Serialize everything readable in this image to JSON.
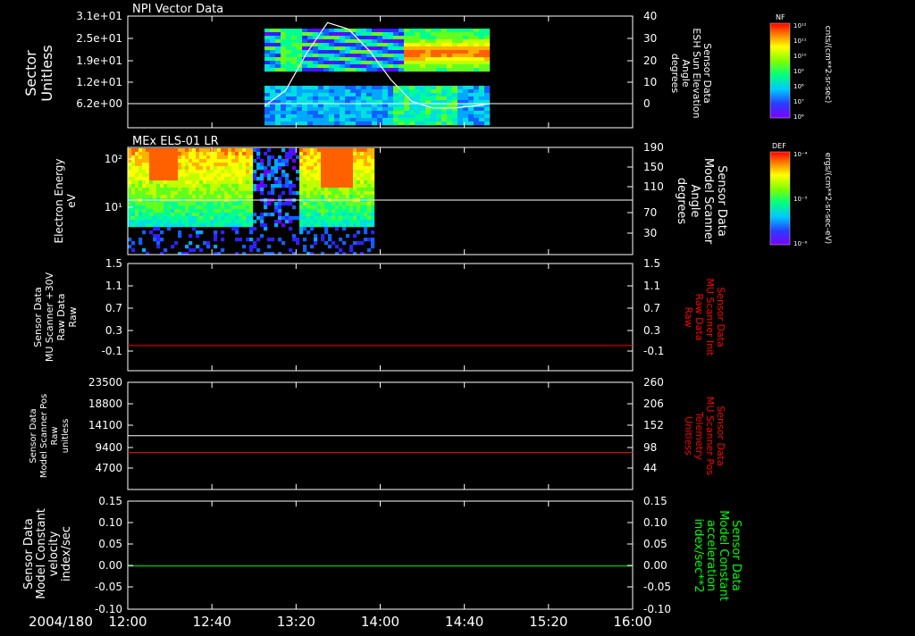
{
  "time_axis": {
    "date_label": "2004/180",
    "ticks": [
      "12:00",
      "12:40",
      "13:20",
      "14:00",
      "14:40",
      "15:20",
      "16:00"
    ],
    "start": "12:00",
    "end": "16:00"
  },
  "colors": {
    "background": "#000000",
    "axis": "#ffffff",
    "red_trace": "#ff0000",
    "green_trace": "#00ff00"
  },
  "chart_data": [
    {
      "type": "heatmap",
      "title": "NPI Vector Data",
      "ylabel": [
        "Sector",
        "Unitless"
      ],
      "yticks": [
        "3.1e+01",
        "2.5e+01",
        "1.9e+01",
        "1.2e+01",
        "6.2e+00"
      ],
      "y2label": [
        "Sensor Data",
        "ESH Sun Elevation",
        "Angle",
        "degrees"
      ],
      "y2ticks": [
        "40",
        "30",
        "20",
        "10",
        "0"
      ],
      "y2lim": [
        -5,
        40
      ],
      "colorbar": {
        "label": "NF",
        "unit": "cnts/(cm**2-sr-sec)",
        "ticks": [
          "10¹²",
          "10¹¹",
          "10¹⁰",
          "10⁹",
          "10⁸",
          "10⁷",
          "10⁶"
        ]
      },
      "data_time_range": [
        "13:05",
        "14:52"
      ],
      "overlay_line": {
        "name": "ESH Sun Elevation",
        "x": [
          "13:05",
          "13:15",
          "13:25",
          "13:35",
          "13:45",
          "13:55",
          "14:05",
          "14:15",
          "14:25",
          "14:35",
          "14:45",
          "14:52"
        ],
        "y": [
          -1,
          6,
          23,
          37,
          34,
          24,
          11,
          1,
          -2,
          -2,
          -1,
          0
        ]
      },
      "horizontal_line": {
        "y2": 0,
        "color": "white"
      }
    },
    {
      "type": "heatmap",
      "title": "MEx ELS-01 LR",
      "ylabel": [
        "Electron Energy",
        "eV"
      ],
      "yticks": [
        "10²",
        "10¹"
      ],
      "ylim": [
        1,
        200
      ],
      "y2label": [
        "Sensor Data",
        "Model Scanner",
        "Angle",
        "degrees"
      ],
      "y2ticks": [
        "190",
        "150",
        "110",
        "70",
        "30"
      ],
      "y2lim": [
        0,
        190
      ],
      "colorbar": {
        "label": "DEF",
        "unit": "ergs/(cm**2-sr-sec-eV)",
        "ticks": [
          "10⁻⁴",
          "10⁻⁵",
          "10⁻⁶"
        ]
      },
      "data_time_range": [
        "12:00",
        "13:56"
      ],
      "horizontal_line": {
        "y2": 90,
        "color": "white"
      }
    },
    {
      "type": "line",
      "ylabel": [
        "Sensor Data",
        "MU Scanner +30V",
        "Raw Data",
        "Raw"
      ],
      "yticks": [
        "1.5",
        "1.1",
        "0.7",
        "0.3",
        "-0.1"
      ],
      "ylim": [
        -0.3,
        1.5
      ],
      "y2label": [
        "Sensor Data",
        "MU Scanner Init",
        "Raw Data",
        "Raw"
      ],
      "y2ticks": [
        "1.5",
        "1.1",
        "0.7",
        "0.3",
        "-0.1"
      ],
      "series": [
        {
          "name": "MU Scanner Init",
          "color": "#ff0000",
          "x": [
            "12:00",
            "16:00"
          ],
          "y": [
            0.0,
            0.0
          ]
        }
      ]
    },
    {
      "type": "line",
      "ylabel": [
        "Sensor Data",
        "Model Scanner Pos",
        "Raw",
        "unitless"
      ],
      "yticks": [
        "23500",
        "18800",
        "14100",
        "9400",
        "4700"
      ],
      "ylim": [
        0,
        23500
      ],
      "y2label": [
        "Sensor Data",
        "MU Scanner Pos",
        "Telemetry",
        "Unitless"
      ],
      "y2ticks": [
        "260",
        "206",
        "152",
        "98",
        "44"
      ],
      "y2lim": [
        0,
        260
      ],
      "series": [
        {
          "name": "Model Scanner Pos",
          "color": "#ffffff",
          "x": [
            "12:00",
            "16:00"
          ],
          "y": [
            11800,
            11800
          ]
        },
        {
          "name": "MU Scanner Pos",
          "color": "#ff0000",
          "x": [
            "12:00",
            "16:00"
          ],
          "y2": [
            90,
            90
          ]
        }
      ]
    },
    {
      "type": "line",
      "ylabel": [
        "Sensor Data",
        "Model Constant",
        "velocity",
        "index/sec"
      ],
      "yticks": [
        "0.15",
        "0.10",
        "0.05",
        "0.00",
        "-0.05",
        "-0.10"
      ],
      "ylim": [
        -0.1,
        0.15
      ],
      "y2label": [
        "Sensor Data",
        "Model Constant",
        "acceleration",
        "index/sec**2"
      ],
      "y2ticks": [
        "0.15",
        "0.10",
        "0.05",
        "0.00",
        "-0.05",
        "-0.10"
      ],
      "series": [
        {
          "name": "Model Constant acceleration",
          "color": "#00ff00",
          "x": [
            "12:00",
            "16:00"
          ],
          "y": [
            0.0,
            0.0
          ]
        }
      ]
    }
  ]
}
